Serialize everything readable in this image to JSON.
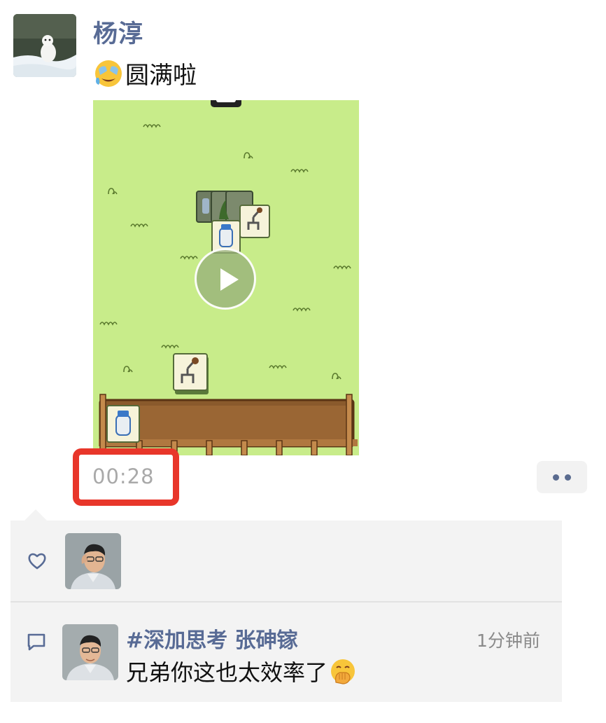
{
  "post": {
    "author_name": "杨淳",
    "text": "圆满啦",
    "emoji_icon": "face-with-tears-icon",
    "video": {
      "duration": "00:28",
      "play_icon": "play-icon"
    },
    "more_icon": "more-dots-icon"
  },
  "interactions": {
    "like_icon": "heart-outline-icon",
    "comment_icon": "comment-bubble-icon",
    "comments": [
      {
        "author": "#深加思考 张砷镓",
        "time": "1分钟前",
        "text": "兄弟你这也太效率了",
        "emoji_icon": "hand-over-mouth-face-icon"
      }
    ]
  },
  "colors": {
    "name_link": "#586b95",
    "highlight_box": "#e8362a",
    "panel_bg": "#f3f3f3",
    "video_grass": "#c8ec8a"
  }
}
